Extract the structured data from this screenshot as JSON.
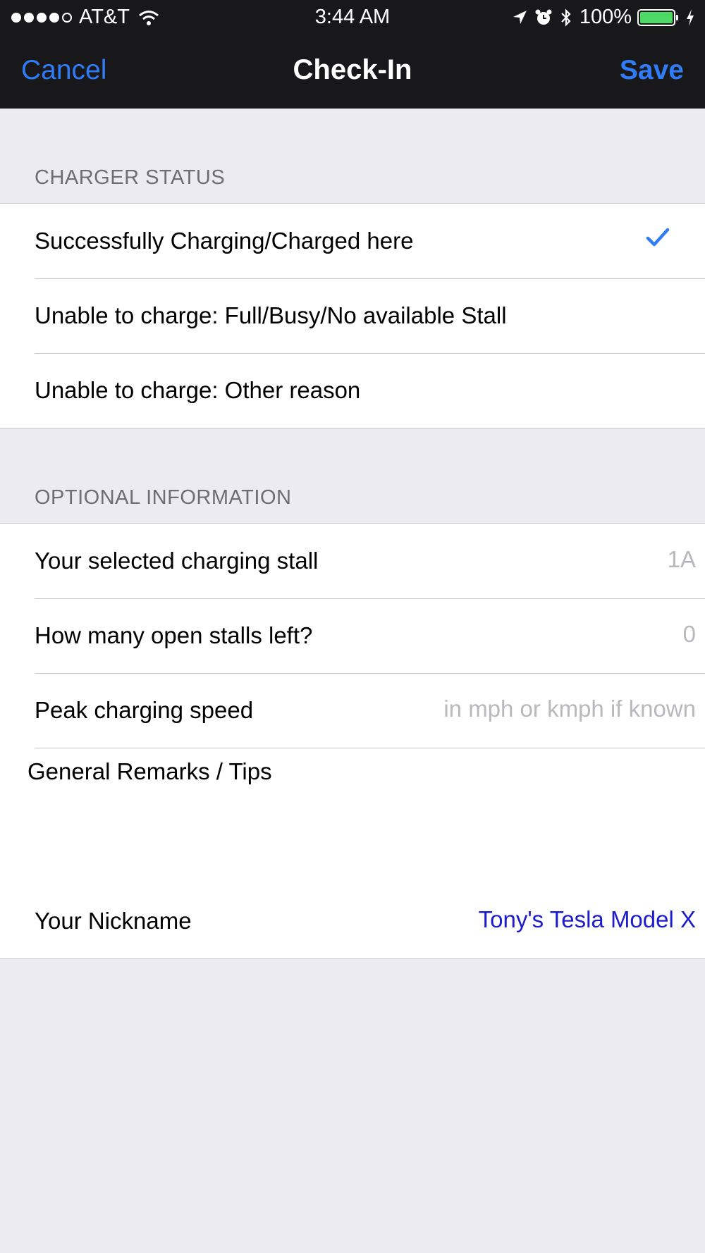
{
  "status_bar": {
    "carrier": "AT&T",
    "time": "3:44 AM",
    "battery": "100%",
    "icons": [
      "signal-dots",
      "wifi-icon",
      "location-arrow-icon",
      "alarm-icon",
      "bluetooth-icon",
      "battery-icon",
      "charging-bolt-icon"
    ],
    "signal_strength": 4
  },
  "nav": {
    "cancel": "Cancel",
    "title": "Check-In",
    "save": "Save"
  },
  "charger_status": {
    "header": "CHARGER STATUS",
    "options": [
      {
        "label": "Successfully Charging/Charged here",
        "selected": true
      },
      {
        "label": "Unable to charge: Full/Busy/No available Stall",
        "selected": false
      },
      {
        "label": "Unable to charge: Other reason",
        "selected": false
      }
    ]
  },
  "optional_info": {
    "header": "OPTIONAL INFORMATION",
    "stall": {
      "label": "Your selected charging stall",
      "placeholder": "1A"
    },
    "open_stalls": {
      "label": "How many open stalls left?",
      "placeholder": "0"
    },
    "peak_speed": {
      "label": "Peak charging speed",
      "placeholder": "in mph or kmph if known"
    },
    "remarks": {
      "label": "General Remarks / Tips"
    },
    "nickname": {
      "label": "Your Nickname",
      "value": "Tony's Tesla Model X"
    }
  },
  "colors": {
    "accent": "#2f7cf6",
    "nav_bg": "#18181b",
    "page_bg": "#ebebf1",
    "nickname": "#1c1ccc",
    "battery": "#4cd964"
  }
}
